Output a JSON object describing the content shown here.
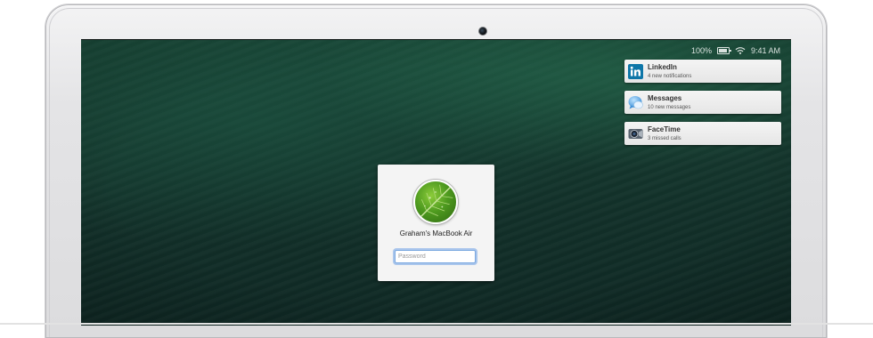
{
  "menubar": {
    "battery": "100%",
    "time": "9:41 AM",
    "icons": [
      "battery-icon",
      "wifi-icon"
    ]
  },
  "notifications": [
    {
      "app": "LinkedIn",
      "detail": "4 new notifications",
      "icon": "linkedin-icon"
    },
    {
      "app": "Messages",
      "detail": "10 new messages",
      "icon": "messages-icon"
    },
    {
      "app": "FaceTime",
      "detail": "3 missed calls",
      "icon": "facetime-icon"
    }
  ],
  "login": {
    "computer_name": "Graham's MacBook Air",
    "password_placeholder": "Password",
    "password_value": "",
    "avatar": "leaf-avatar"
  },
  "colors": {
    "wallpaper": "#15382e",
    "focus_ring": "#7aa8e0",
    "linkedin_blue": "#0e76a8"
  }
}
